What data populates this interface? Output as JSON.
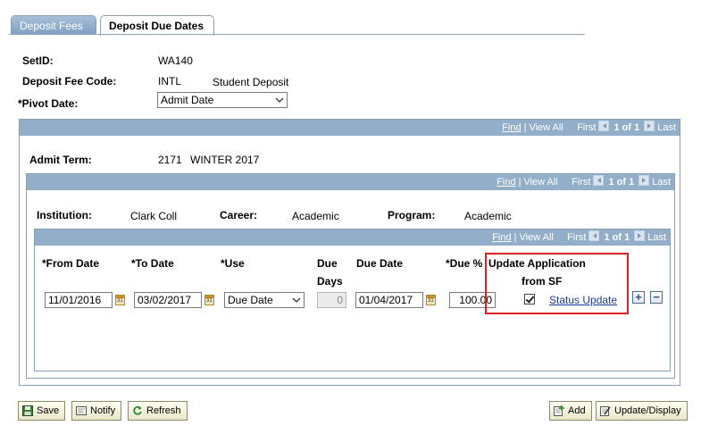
{
  "tabs": [
    {
      "label": "Deposit Fees",
      "active": false
    },
    {
      "label": "Deposit Due Dates",
      "active": true
    }
  ],
  "header": {
    "setid_label": "SetID:",
    "setid_value": "WA140",
    "fee_code_label": "Deposit Fee Code:",
    "fee_code_value": "INTL",
    "fee_code_desc": "Student Deposit",
    "pivot_label": "*Pivot Date:",
    "pivot_value": "Admit Date"
  },
  "nav": {
    "find": "Find",
    "sep": "|",
    "view_all": "View All",
    "first": "First",
    "count": "1 of 1",
    "last": "Last"
  },
  "admit": {
    "label": "Admit Term:",
    "code": "2171",
    "desc": "WINTER 2017"
  },
  "program_info": {
    "institution_label": "Institution:",
    "institution_value": "Clark Coll",
    "career_label": "Career:",
    "career_value": "Academic",
    "program_label": "Program:",
    "program_value": "Academic"
  },
  "grid": {
    "col_from": "*From Date",
    "col_to": "*To Date",
    "col_use": "*Use",
    "col_due_days_1": "Due",
    "col_due_days_2": "Days",
    "col_due_date": "Due Date",
    "col_due_pct": "*Due %",
    "col_update_1": "Update Application",
    "col_update_2": "from SF",
    "row": {
      "from_date": "11/01/2016",
      "to_date": "03/02/2017",
      "use": "Due Date",
      "due_days": "0",
      "due_date": "01/04/2017",
      "due_pct": "100.00",
      "update_checked": true,
      "status_link": "Status Update"
    },
    "add_symbol": "+",
    "remove_symbol": "−",
    "cal_glyph": "31"
  },
  "buttons": {
    "save": "Save",
    "notify": "Notify",
    "refresh": "Refresh",
    "add": "Add",
    "update_display": "Update/Display"
  },
  "colors": {
    "nav_bar": "#93aec9",
    "highlight_box": "#e02020",
    "link": "#1a3a9c"
  }
}
